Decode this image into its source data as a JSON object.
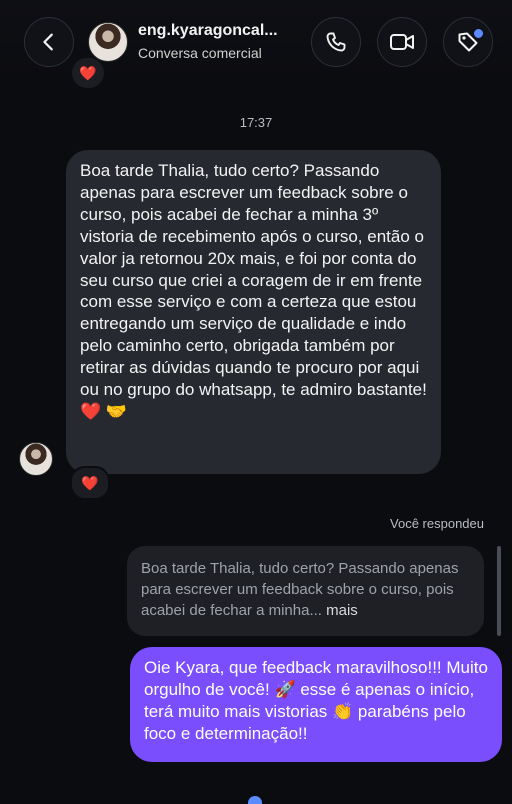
{
  "header": {
    "contact_name": "eng.kyaragoncal...",
    "contact_subtitle": "Conversa comercial",
    "buttons": [
      "back-arrow-icon",
      "phone-icon",
      "video-camera-icon",
      "tag-icon"
    ]
  },
  "colors": {
    "background": "#0b0c10",
    "received_bubble": "#262930",
    "sent_bubble": "#7a4dfd",
    "quote_bubble": "#1e2026",
    "notification_dot": "#5b8cff"
  },
  "thread": {
    "timestamp": "17:37",
    "received_message": {
      "text": "Boa tarde Thalia, tudo certo? Passando apenas para escrever um feedback sobre o curso, pois acabei de fechar a minha 3º vistoria de recebimento após o curso, então o valor ja retornou 20x mais, e foi por conta do seu curso que criei a coragem de ir em frente com esse serviço e com a certeza que estou entregando um serviço de qualidade e indo pelo caminho certo, obrigada também por retirar as dúvidas quando te procuro por aqui ou no grupo do whatsapp, te admiro bastante!",
      "emojis": [
        "❤️",
        "🤝"
      ],
      "reaction": "❤️"
    },
    "top_reaction": "❤️",
    "reply_label": "Você respondeu",
    "quoted_message": {
      "text": "Boa tarde Thalia, tudo certo? Passando apenas para escrever um feedback sobre o curso, pois acabei de fechar a minha...",
      "more": "mais"
    },
    "sent_message": {
      "part1": "Oie Kyara, que feedback maravilhoso!!! Muito orgulho de você!",
      "emoji1": "🚀",
      "part2": "esse é apenas o início, terá muito mais vistorias",
      "emoji2": "👏",
      "part3": "parabéns pelo foco e determinação!!"
    }
  }
}
